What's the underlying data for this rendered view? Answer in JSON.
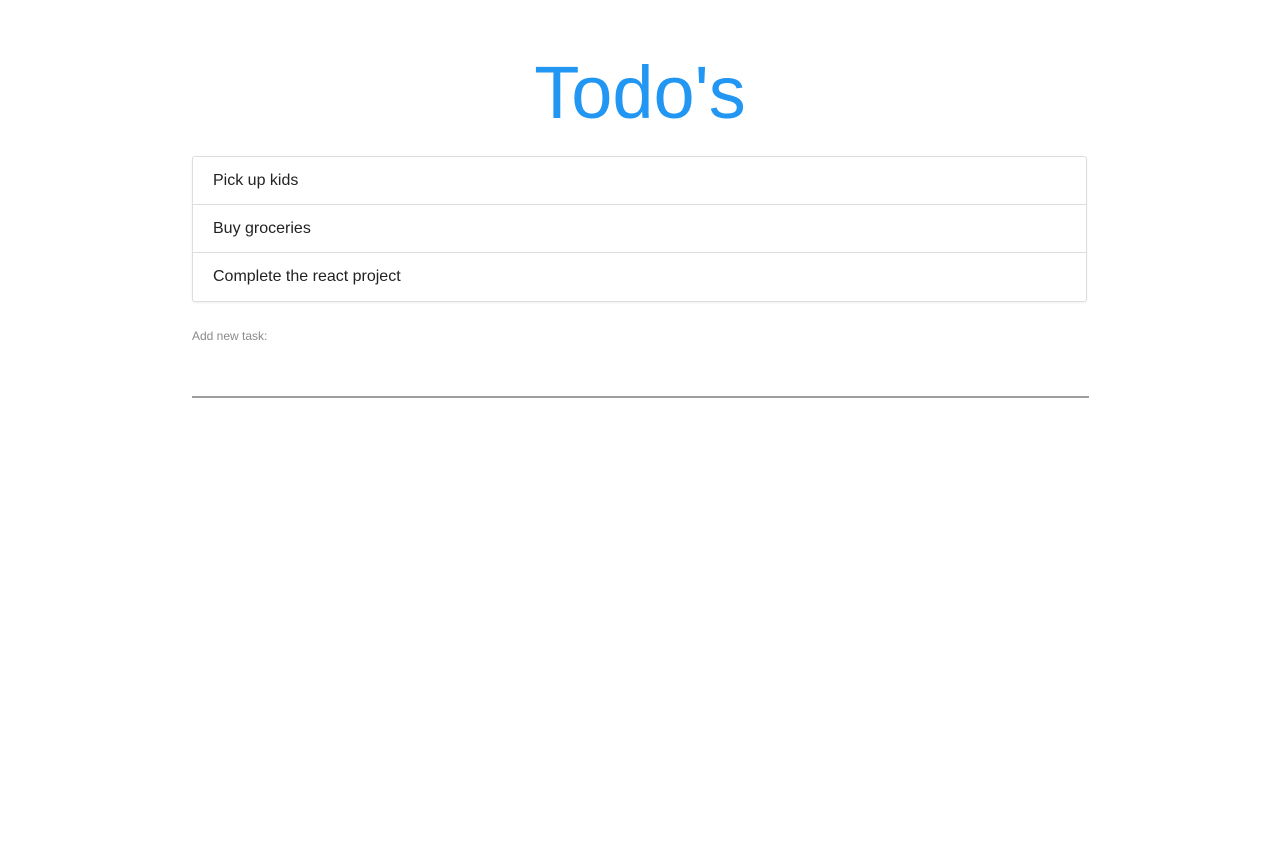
{
  "header": {
    "title": "Todo's",
    "title_color": "#2196f3"
  },
  "todos": [
    {
      "text": "Pick up kids"
    },
    {
      "text": "Buy groceries"
    },
    {
      "text": "Complete the react project"
    }
  ],
  "add_form": {
    "label": "Add new task:",
    "input_value": "",
    "input_placeholder": ""
  }
}
